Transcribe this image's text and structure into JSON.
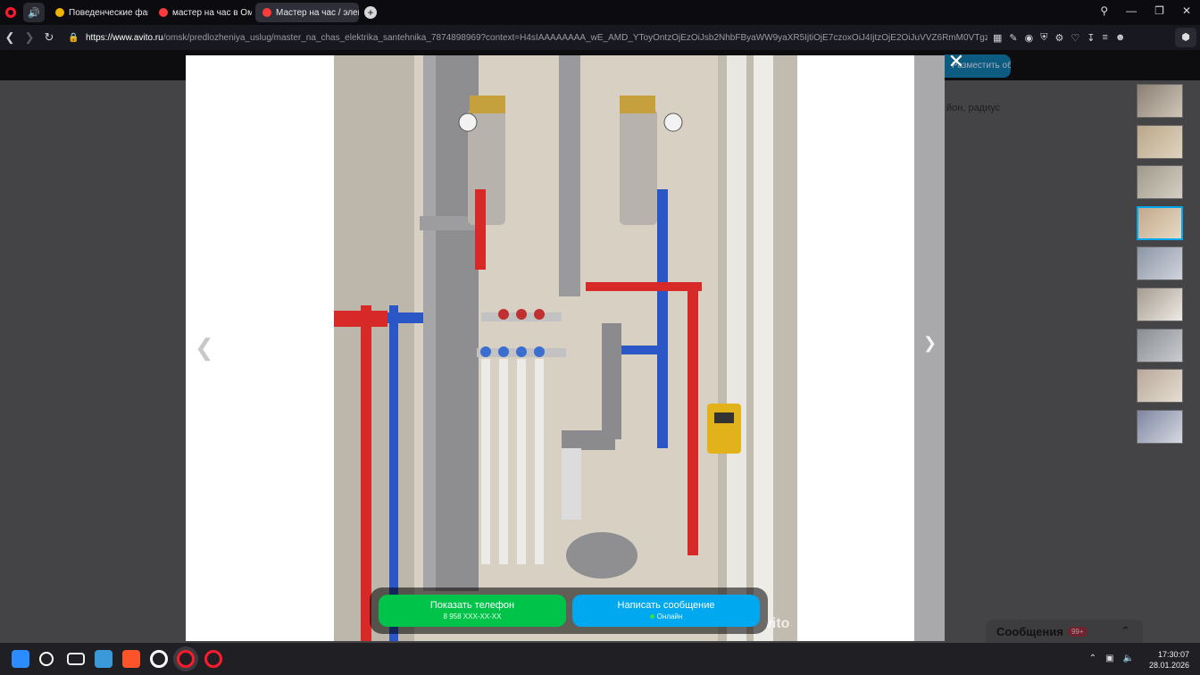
{
  "browser": {
    "tabs": [
      {
        "label": "Поведенческие факторы",
        "favicon_color": "#f0b400",
        "active": false
      },
      {
        "label": "мастер на час в Омске -",
        "favicon_color": "#ff3b3b",
        "active": false
      },
      {
        "label": "Мастер на час / электри",
        "favicon_color": "#ff3b3b",
        "active": true
      }
    ],
    "new_tab_label": "+",
    "url_host": "https://www.avito.ru",
    "url_path": "/omsk/predlozheniya_uslug/master_na_chas_elektrika_santehnika_7874898969?context=H4sIAAAAAAAA_wE_AMD_YToyOntzOjEzOiJsb2NhbFByaWW9yaXR5IjtiOjE7czoxOiJ4IjtzOjE2OiJuVVZ6RmM0VTgzMUpKTzE3Ijt9yrm11z8AAAA#ext"
  },
  "page": {
    "place_ad_label": "Разместить объявление",
    "background_snippet": "йон, радиус",
    "messages_label": "Сообщения",
    "messages_badge": "99+"
  },
  "gallery": {
    "close_icon": "close-icon",
    "prev_icon": "chevron-left-icon",
    "next_icon": "chevron-right-icon",
    "watermark": "vito",
    "thumbnail_count": 9,
    "selected_thumbnail": 4,
    "thumbnail_colors": [
      "#8a7f73",
      "#b9a78a",
      "#9f9a8c",
      "#c2a98c",
      "#8c96a6",
      "#a59b91",
      "#8a8d91",
      "#b8a89a",
      "#7e86a1"
    ]
  },
  "cta": {
    "phone_label": "Показать телефон",
    "phone_number": "8 958 XXX-XX-XX",
    "write_label": "Написать сообщение",
    "online_label": "Онлайн"
  },
  "taskbar": {
    "time": "17:30:07",
    "date": "28.01.2026"
  }
}
